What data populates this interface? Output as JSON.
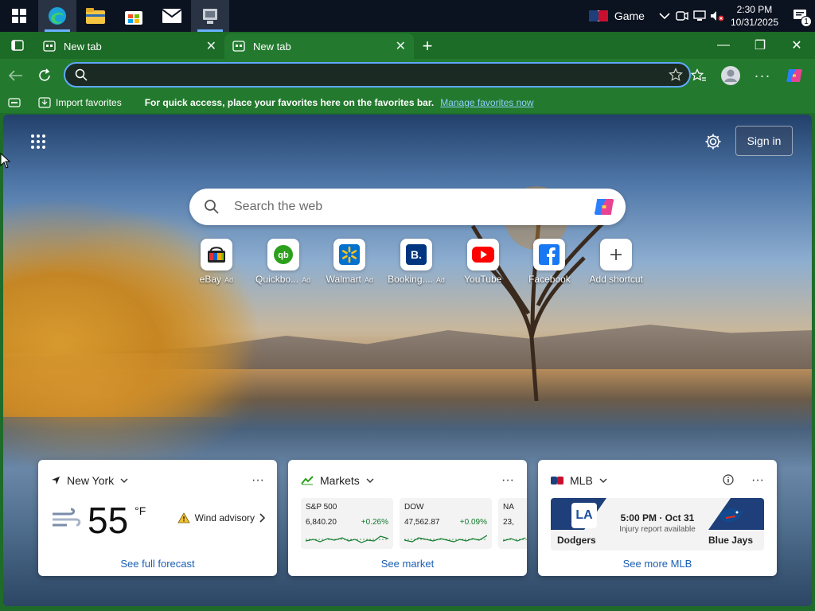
{
  "taskbar": {
    "game_label": "Game",
    "time": "2:30 PM",
    "date": "10/31/2025",
    "notifications": "1"
  },
  "tabs": [
    {
      "title": "New tab"
    },
    {
      "title": "New tab"
    }
  ],
  "toolbar": {
    "address_value": "",
    "address_placeholder": ""
  },
  "favorites_bar": {
    "import_label": "Import favorites",
    "hint": "For quick access, place your favorites here on the favorites bar.",
    "manage_link": "Manage favorites now"
  },
  "newtab": {
    "signin_label": "Sign in",
    "search_placeholder": "Search the web",
    "shortcuts": [
      {
        "label": "eBay",
        "ad": "Ad",
        "icon": "ebay-icon"
      },
      {
        "label": "Quickbo...",
        "ad": "Ad",
        "icon": "quickbooks-icon"
      },
      {
        "label": "Walmart",
        "ad": "Ad",
        "icon": "walmart-icon"
      },
      {
        "label": "Booking....",
        "ad": "Ad",
        "icon": "booking-icon"
      },
      {
        "label": "YouTube",
        "ad": "",
        "icon": "youtube-icon"
      },
      {
        "label": "Facebook",
        "ad": "",
        "icon": "facebook-icon"
      },
      {
        "label": "Add shortcut",
        "ad": "",
        "icon": "plus-icon"
      }
    ]
  },
  "weather": {
    "location": "New York",
    "temperature": "55",
    "unit": "°F",
    "alert": "Wind advisory",
    "link": "See full forecast"
  },
  "markets": {
    "title": "Markets",
    "items": [
      {
        "name": "S&P 500",
        "value": "6,840.20",
        "change": "+0.26%"
      },
      {
        "name": "DOW",
        "value": "47,562.87",
        "change": "+0.09%"
      },
      {
        "name": "NA",
        "value": "23,",
        "change": ""
      }
    ],
    "link": "See market"
  },
  "mlb": {
    "title": "MLB",
    "home_abbr": "LA",
    "home_team": "Dodgers",
    "away_team": "Blue Jays",
    "game_time": "5:00 PM · Oct 31",
    "game_note": "Injury report available",
    "link": "See more MLB"
  },
  "colors": {
    "accent": "#5fa8ff",
    "tab_green": "#237a2e",
    "link_blue": "#1a5fb4",
    "up_green": "#117a2b"
  }
}
